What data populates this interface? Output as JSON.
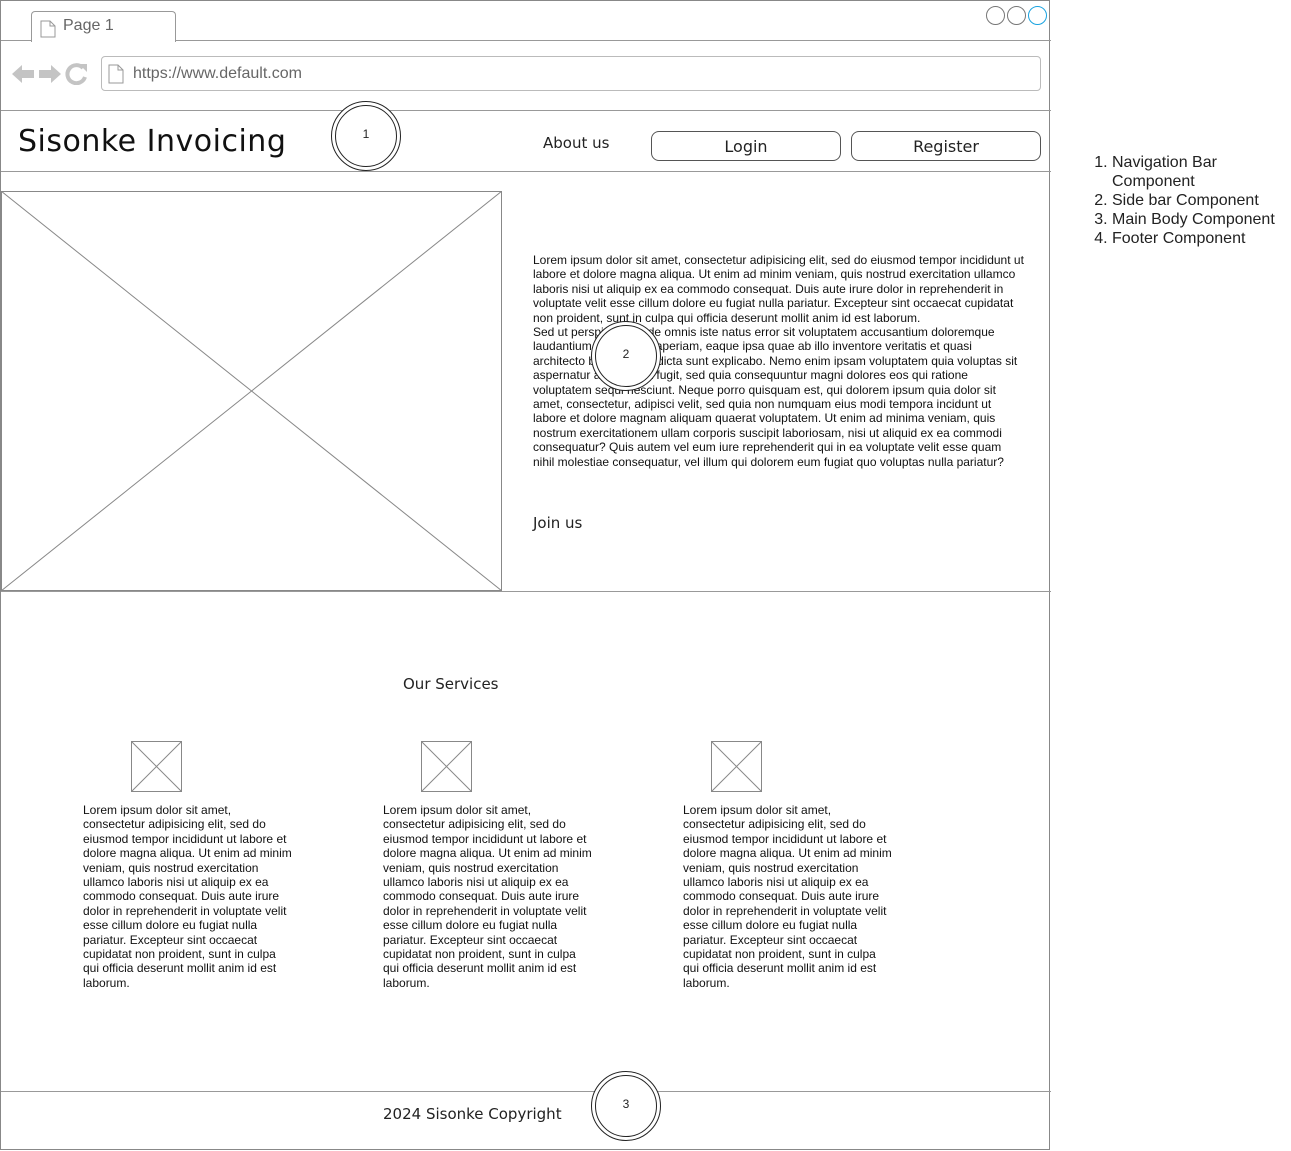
{
  "browser": {
    "tab_label": "Page 1",
    "url": "https://www.default.com"
  },
  "navbar": {
    "brand": "Sisonke Invoicing",
    "about": "About us",
    "login": "Login",
    "register": "Register"
  },
  "callouts": {
    "one": "1",
    "two": "2",
    "three": "3"
  },
  "hero": {
    "paragraph_1": "Lorem ipsum dolor sit amet, consectetur adipisicing elit, sed do eiusmod tempor incididunt ut labore et dolore magna aliqua. Ut enim ad minim veniam, quis nostrud exercitation ullamco laboris nisi ut aliquip ex ea commodo consequat. Duis aute irure dolor in reprehenderit in voluptate velit esse cillum dolore eu fugiat nulla pariatur. Excepteur sint occaecat cupidatat non proident, sunt in culpa qui officia deserunt mollit anim id est laborum.",
    "paragraph_2": "Sed ut perspiciatis unde omnis iste natus error sit voluptatem accusantium doloremque laudantium, totam rem aperiam, eaque ipsa quae ab illo inventore veritatis et quasi architecto beatae vitae dicta sunt explicabo. Nemo enim ipsam voluptatem quia voluptas sit aspernatur aut odit aut fugit, sed quia consequuntur magni dolores eos qui ratione voluptatem sequi nesciunt. Neque porro quisquam est, qui dolorem ipsum quia dolor sit amet, consectetur, adipisci velit, sed quia non numquam eius modi tempora incidunt ut labore et dolore magnam aliquam quaerat voluptatem. Ut enim ad minima veniam, quis nostrum exercitationem ullam corporis suscipit laboriosam, nisi ut aliquid ex ea commodi consequatur? Quis autem vel eum iure reprehenderit qui in ea voluptate velit esse quam nihil molestiae consequatur, vel illum qui dolorem eum fugiat quo voluptas nulla pariatur?",
    "join": "Join us"
  },
  "services": {
    "title": "Our Services",
    "items": [
      {
        "text": "Lorem ipsum dolor sit amet, consectetur adipisicing elit, sed do eiusmod tempor incididunt ut labore et dolore magna aliqua. Ut enim ad minim veniam, quis nostrud exercitation ullamco laboris nisi ut aliquip ex ea commodo consequat. Duis aute irure dolor in reprehenderit in voluptate velit esse cillum dolore eu fugiat nulla pariatur. Excepteur sint occaecat cupidatat non proident, sunt in culpa qui officia deserunt mollit anim id est laborum."
      },
      {
        "text": "Lorem ipsum dolor sit amet, consectetur adipisicing elit, sed do eiusmod tempor incididunt ut labore et dolore magna aliqua. Ut enim ad minim veniam, quis nostrud exercitation ullamco laboris nisi ut aliquip ex ea commodo consequat. Duis aute irure dolor in reprehenderit in voluptate velit esse cillum dolore eu fugiat nulla pariatur. Excepteur sint occaecat cupidatat non proident, sunt in culpa qui officia deserunt mollit anim id est laborum."
      },
      {
        "text": "Lorem ipsum dolor sit amet, consectetur adipisicing elit, sed do eiusmod tempor incididunt ut labore et dolore magna aliqua. Ut enim ad minim veniam, quis nostrud exercitation ullamco laboris nisi ut aliquip ex ea commodo consequat. Duis aute irure dolor in reprehenderit in voluptate velit esse cillum dolore eu fugiat nulla pariatur. Excepteur sint occaecat cupidatat non proident, sunt in culpa qui officia deserunt mollit anim id est laborum."
      }
    ]
  },
  "footer": {
    "copyright": "2024 Sisonke Copyright"
  },
  "legend": {
    "items": [
      "Navigation Bar Component",
      "Side bar Component",
      "Main Body Component",
      "Footer Component"
    ]
  }
}
